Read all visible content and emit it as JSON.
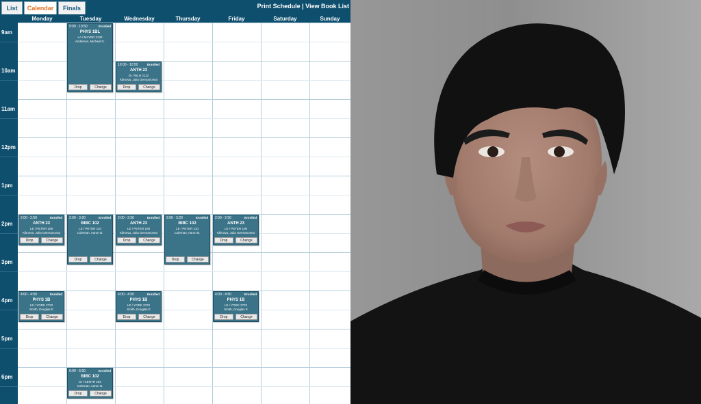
{
  "tabs": [
    {
      "label": "List",
      "active": false
    },
    {
      "label": "Calendar",
      "active": true
    },
    {
      "label": "Finals",
      "active": false
    }
  ],
  "links": {
    "print": "Print Schedule",
    "separator": " | ",
    "books": "View Book List"
  },
  "days": [
    "Monday",
    "Tuesday",
    "Wednesday",
    "Thursday",
    "Friday",
    "Saturday",
    "Sunday"
  ],
  "hours": [
    "9am",
    "10am",
    "11am",
    "12pm",
    "1pm",
    "2pm",
    "3pm",
    "4pm",
    "5pm",
    "6pm"
  ],
  "buttons": {
    "drop": "Drop",
    "change": "Change"
  },
  "events": [
    {
      "day": 1,
      "start": 9.0,
      "end": 10.83,
      "time": "9:00 - 10:50",
      "status": "Enrolled",
      "code": "PHYS 1BL",
      "location": "LA / MAYER 2130",
      "instructor": "Anderson, Michael G."
    },
    {
      "day": 2,
      "start": 10.0,
      "end": 10.83,
      "time": "10:00 - 10:50",
      "status": "Enrolled",
      "code": "ANTH 23",
      "location": "DI / WLH 2112",
      "instructor": "Klimova, Julia Germanovna"
    },
    {
      "day": 0,
      "start": 14.0,
      "end": 14.83,
      "time": "2:00 - 2:50",
      "status": "Enrolled",
      "code": "ANTH 23",
      "location": "LE / PETER 108",
      "instructor": "Klimova, Julia Germanovna"
    },
    {
      "day": 1,
      "start": 14.0,
      "end": 15.33,
      "time": "2:00 - 3:20",
      "status": "Enrolled",
      "code": "BIBC 102",
      "location": "LE / PETER 110",
      "instructor": "Coleman, Aaron B."
    },
    {
      "day": 2,
      "start": 14.0,
      "end": 14.83,
      "time": "2:00 - 2:50",
      "status": "Enrolled",
      "code": "ANTH 23",
      "location": "LE / PETER 108",
      "instructor": "Klimova, Julia Germanovna"
    },
    {
      "day": 3,
      "start": 14.0,
      "end": 15.33,
      "time": "2:00 - 3:20",
      "status": "Enrolled",
      "code": "BIBC 102",
      "location": "LE / PETER 110",
      "instructor": "Coleman, Aaron B."
    },
    {
      "day": 4,
      "start": 14.0,
      "end": 14.83,
      "time": "2:00 - 2:50",
      "status": "Enrolled",
      "code": "ANTH 23",
      "location": "LE / PETER 108",
      "instructor": "Klimova, Julia Germanovna"
    },
    {
      "day": 0,
      "start": 16.0,
      "end": 16.83,
      "time": "4:00 - 4:50",
      "status": "Enrolled",
      "code": "PHYS 1B",
      "location": "LE / YORK 2722",
      "instructor": "Smith, Douglas E"
    },
    {
      "day": 2,
      "start": 16.0,
      "end": 16.83,
      "time": "4:00 - 4:50",
      "status": "Enrolled",
      "code": "PHYS 1B",
      "location": "LE / YORK 2722",
      "instructor": "Smith, Douglas E"
    },
    {
      "day": 4,
      "start": 16.0,
      "end": 16.83,
      "time": "4:00 - 4:50",
      "status": "Enrolled",
      "code": "PHYS 1B",
      "location": "LE / YORK 2722",
      "instructor": "Smith, Douglas E"
    },
    {
      "day": 1,
      "start": 18.0,
      "end": 18.83,
      "time": "6:00 - 6:50",
      "status": "Enrolled",
      "code": "BIBC 102",
      "location": "DI / CENTR 203",
      "instructor": "Coleman, Aaron B."
    }
  ],
  "colors": {
    "header": "#0f4f6e",
    "event": "#3b7388",
    "active_tab": "#e0701f",
    "grid_line": "#b4cddc"
  }
}
